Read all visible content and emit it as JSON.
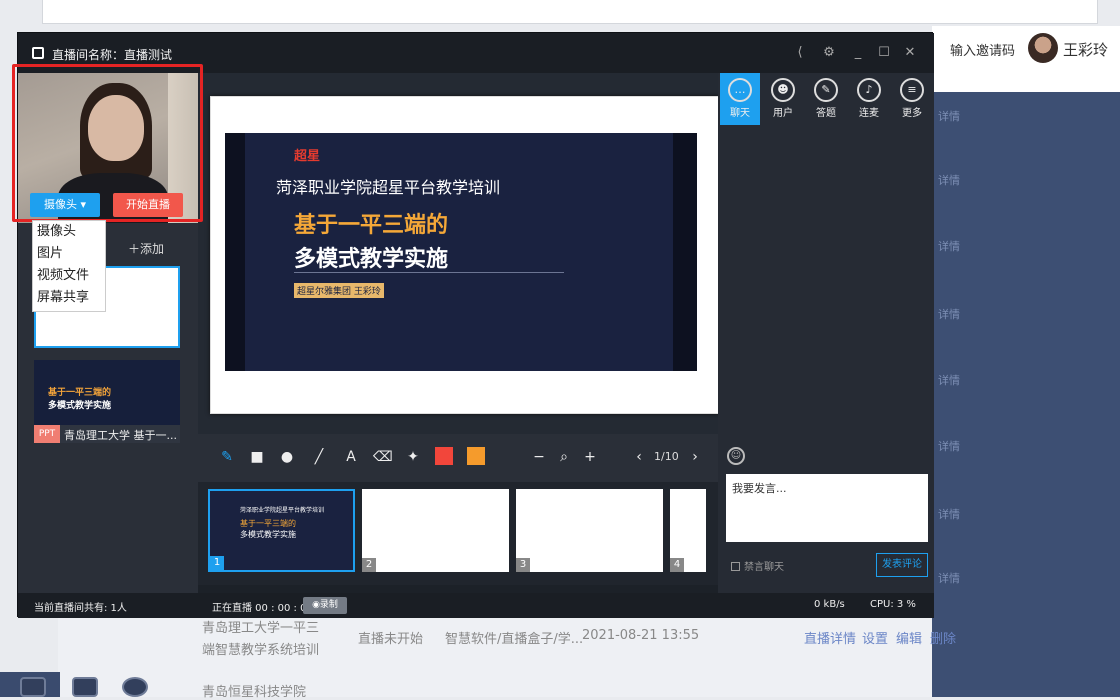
{
  "window": {
    "title": "直播间名称：直播测试",
    "status": {
      "viewers": "当前直播间共有: 1人",
      "live_time": "正在直播 00 : 00 : 00",
      "record": "◉录制",
      "bandwidth": "0 kB/s",
      "cpu": "CPU: 3 %"
    }
  },
  "header": {
    "invite_code": "输入邀请码",
    "user_name": "王彩玲"
  },
  "left": {
    "camera_select": "摄像头",
    "start_live": "开始直播",
    "source_menu": [
      "摄像头",
      "图片",
      "视频文件",
      "屏幕共享"
    ],
    "add": "＋添加",
    "slot2_line1": "基于一平三端的",
    "slot2_line2": "多模式教学实施",
    "ppt_badge": "PPT",
    "ppt_name": "青岛理工大学 基于一..."
  },
  "slide": {
    "logo": "超星",
    "caption": "菏泽职业学院超星平台教学培训",
    "title1": "基于一平三端的",
    "title2": "多模式教学实施",
    "tag": "超星尔雅集团 王彩玲"
  },
  "toolbar": {
    "page": "1/10",
    "thumb1_caption": "菏泽职业学院超星平台教学培训",
    "thumb1_title1": "基于一平三端的",
    "thumb1_title2": "多模式教学实施",
    "thumb_numbers": [
      "1",
      "2",
      "3",
      "4"
    ],
    "colors": {
      "red": "#f2463b",
      "orange": "#f59b2c"
    }
  },
  "right": {
    "tabs": [
      "聊天",
      "用户",
      "答题",
      "连麦",
      "更多"
    ],
    "chat_placeholder": "我要发言...",
    "ban_chat": "禁言聊天",
    "send": "发表评论"
  },
  "background": {
    "row1_name": "青岛理工大学一平三",
    "row1_name2": "端智慧教学系统培训",
    "row1_status": "直播未开始",
    "row1_tool": "智慧软件/直播盒子/学...",
    "row1_time": "2021-08-21 13:55",
    "row1_actions": [
      "直播详情",
      "设置",
      "编辑",
      "删除"
    ],
    "row2_name": "青岛恒星科技学院"
  }
}
